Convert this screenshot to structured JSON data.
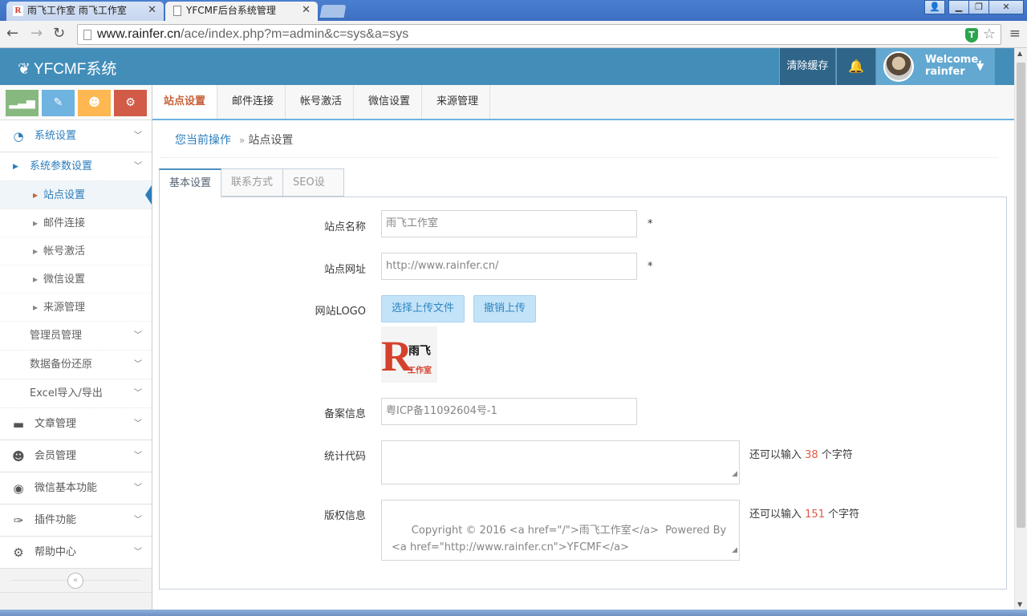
{
  "browser": {
    "tabs": [
      {
        "title": "雨飞工作室 雨飞工作室",
        "favicon": "R"
      },
      {
        "title": "YFCMF后台系统管理"
      }
    ],
    "url_host": "www.rainfer.cn",
    "url_path": "/ace/index.php?m=admin&c=sys&a=sys",
    "extension_label": "T"
  },
  "navbar": {
    "brand": "YFCMF系统",
    "clear_cache": "清除缓存",
    "welcome": "Welcome,",
    "username": "rainfer"
  },
  "sidebar": {
    "menu": [
      {
        "label": "系统设置",
        "icon": "dashboard-icon"
      },
      {
        "label": "文章管理",
        "icon": "folder-icon"
      },
      {
        "label": "会员管理",
        "icon": "users-icon"
      },
      {
        "label": "微信基本功能",
        "icon": "wechat-icon"
      },
      {
        "label": "插件功能",
        "icon": "wrench-icon"
      },
      {
        "label": "帮助中心",
        "icon": "cogs-icon"
      }
    ],
    "sys_sub": [
      "系统参数设置",
      "管理员管理",
      "数据备份还原",
      "Excel导入/导出"
    ],
    "param_items": [
      "站点设置",
      "邮件连接",
      "帐号激活",
      "微信设置",
      "来源管理"
    ]
  },
  "top_tabs": [
    "站点设置",
    "邮件连接",
    "帐号激活",
    "微信设置",
    "来源管理"
  ],
  "breadcrumb": {
    "current_op": "您当前操作",
    "page": "站点设置"
  },
  "form_tabs": [
    "基本设置",
    "联系方式",
    "SEO设置"
  ],
  "form": {
    "site_name_label": "站点名称",
    "site_name_value": "雨飞工作室",
    "site_url_label": "站点网址",
    "site_url_value": "http://www.rainfer.cn/",
    "required_mark": "*",
    "logo_label": "网站LOGO",
    "upload_btn": "选择上传文件",
    "cancel_upload_btn": "撤销上传",
    "logo_text_main": "雨飞",
    "logo_text_sub": "工作室",
    "icp_label": "备案信息",
    "icp_value": "粤ICP备11092604号-1",
    "stats_label": "统计代码",
    "stats_value": "",
    "copyright_label": "版权信息",
    "copyright_value": "Copyright © 2016 <a href=\"/\">雨飞工作室</a>  Powered By <a href=\"http://www.rainfer.cn\">YFCMF</a>",
    "hint_prefix": "还可以输入",
    "hint_suffix": "个字符",
    "stats_remaining": "38",
    "copyright_remaining": "151"
  },
  "colors": {
    "navbar": "#438eb9",
    "accent_blue": "#2b7dbc",
    "active_tab": "#c86139",
    "counter_red": "#dd5a43"
  }
}
